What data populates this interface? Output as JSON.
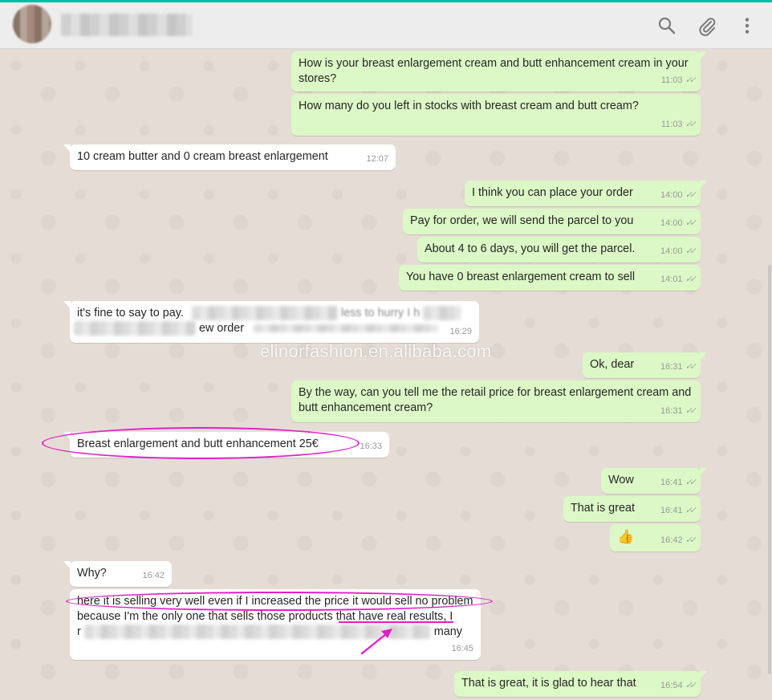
{
  "header": {
    "search_icon": "search-icon",
    "attach_icon": "paperclip-icon",
    "menu_icon": "kebab-menu-icon"
  },
  "colors": {
    "outgoing": "#dcf8c6",
    "incoming": "#ffffff",
    "background": "#e5ddd5",
    "highlight": "#e020c8"
  },
  "messages": [
    {
      "dir": "out",
      "text": "How is your breast enlargement cream and butt enhancement cream in your stores?",
      "time": "11:03"
    },
    {
      "dir": "out",
      "text": "How many do you left in stocks with breast cream and butt cream?",
      "time": "11:03"
    },
    {
      "dir": "in",
      "text": "10 cream butter and 0 cream breast enlargement",
      "time": "12:07"
    },
    {
      "dir": "out",
      "text": "I think you can place your order",
      "time": "14:00"
    },
    {
      "dir": "out",
      "text": "Pay for order, we will send the parcel to you",
      "time": "14:00"
    },
    {
      "dir": "out",
      "text": "About 4 to 6 days, you will get the parcel.",
      "time": "14:00"
    },
    {
      "dir": "out",
      "text": "You have 0 breast enlargement cream to sell",
      "time": "14:01"
    },
    {
      "dir": "in",
      "text": "it's fine to say to pay.",
      "text_b": "less to hurry I h",
      "text_c": "ew order",
      "time": "16:29"
    },
    {
      "dir": "out",
      "text": "Ok, dear",
      "time": "16:31"
    },
    {
      "dir": "out",
      "text": "By the way, can you tell me the retail price for breast enlargement cream and butt enhancement cream?",
      "time": "16:31"
    },
    {
      "dir": "in",
      "text": "Breast enlargement and butt enhancement  25€",
      "time": "16:33"
    },
    {
      "dir": "out",
      "text": "Wow",
      "time": "16:41"
    },
    {
      "dir": "out",
      "text": "That is great",
      "time": "16:41"
    },
    {
      "dir": "out",
      "text": "👍",
      "time": "16:42"
    },
    {
      "dir": "in",
      "text": "Why?",
      "time": "16:42"
    },
    {
      "dir": "in",
      "text": "here it is selling very well even if I increased the price it would sell no problem",
      "text_b": "because I'm the only one that sells those products that have real results, I",
      "text_c": "r",
      "text_d": "many",
      "time": "16:45"
    },
    {
      "dir": "out",
      "text": "That is great, it is glad to hear that",
      "time": "16:54"
    }
  ],
  "watermark": "elinorfashion.en.alibaba.com"
}
